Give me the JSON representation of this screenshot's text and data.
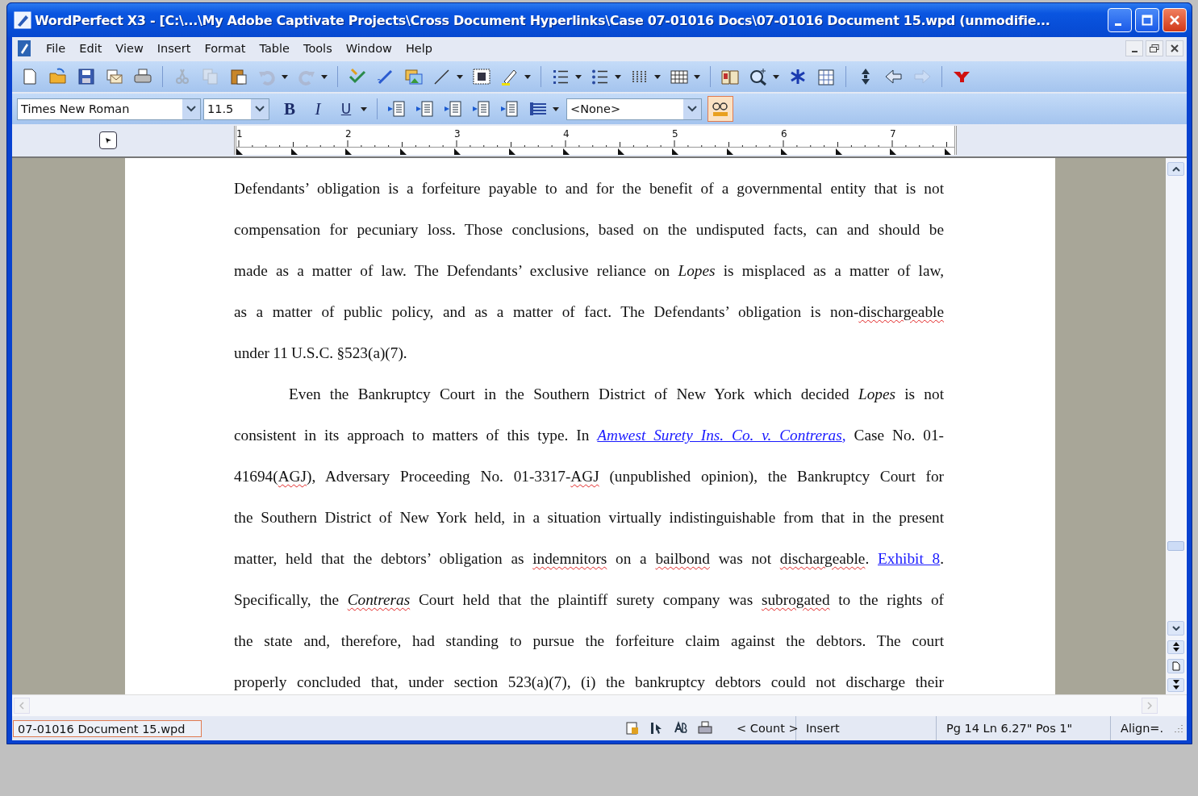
{
  "window": {
    "title": "WordPerfect X3 - [C:\\...\\My Adobe Captivate Projects\\Cross Document Hyperlinks\\Case 07-01016 Docs\\07-01016 Document 15.wpd (unmodifie..."
  },
  "menu": [
    "File",
    "Edit",
    "View",
    "Insert",
    "Format",
    "Table",
    "Tools",
    "Window",
    "Help"
  ],
  "property_bar": {
    "font": "Times New Roman",
    "size": "11.5",
    "bold": "B",
    "italic": "I",
    "underline": "U",
    "style": "<None>"
  },
  "ruler": {
    "numbers": [
      "1",
      "2",
      "3",
      "4",
      "5",
      "6",
      "7"
    ]
  },
  "document": {
    "paragraphs": [
      {
        "first_line_indent": false,
        "continues": false,
        "lines": [
          [
            {
              "kind": "text",
              "text": "Defendants’ obligation is a forfeiture payable to and for the benefit of a governmental entity that is not"
            }
          ],
          [
            {
              "kind": "text",
              "text": "compensation for pecuniary loss. Those conclusions, based on the undisputed facts, can and should be"
            }
          ],
          [
            {
              "kind": "text",
              "text": "made as a matter of law. The Defendants’ exclusive reliance on *Lopes* is misplaced as a matter of law,"
            }
          ],
          [
            {
              "kind": "text",
              "text": "as a matter of public policy, and as a matter of fact. The Defendants’ obligation is non-"
            },
            {
              "kind": "misspelled",
              "text": "dischargeable"
            }
          ],
          [
            {
              "kind": "text",
              "text": "under 11 U.S.C. §523(a)(7)."
            }
          ]
        ]
      },
      {
        "first_line_indent": true,
        "continues": true,
        "lines": [
          [
            {
              "kind": "text",
              "text": "Even the Bankruptcy Court in the Southern District of New York which decided *Lopes* is not"
            }
          ],
          [
            {
              "kind": "text",
              "text": "consistent in its approach to matters of this type. In "
            },
            {
              "kind": "link",
              "text": "*Amwest Surety Ins. Co. v. Contreras*,"
            },
            {
              "kind": "text",
              "text": " Case No. 01-"
            }
          ],
          [
            {
              "kind": "text",
              "text": "41694("
            },
            {
              "kind": "misspelled",
              "text": "AGJ"
            },
            {
              "kind": "text",
              "text": "), Adversary Proceeding No. 01-3317-"
            },
            {
              "kind": "misspelled",
              "text": "AGJ"
            },
            {
              "kind": "text",
              "text": " (unpublished opinion), the Bankruptcy Court for"
            }
          ],
          [
            {
              "kind": "text",
              "text": "the Southern District of New York held, in a situation virtually indistinguishable from that in the present"
            }
          ],
          [
            {
              "kind": "text",
              "text": "matter, held that the debtors’ obligation as "
            },
            {
              "kind": "misspelled",
              "text": "indemnitors"
            },
            {
              "kind": "text",
              "text": " on a "
            },
            {
              "kind": "misspelled",
              "text": "bailbond"
            },
            {
              "kind": "text",
              "text": " was not "
            },
            {
              "kind": "misspelled",
              "text": "dischargeable"
            },
            {
              "kind": "text",
              "text": ". "
            },
            {
              "kind": "link",
              "text": "Exhibit 8"
            },
            {
              "kind": "text",
              "text": "."
            }
          ],
          [
            {
              "kind": "text",
              "text": "Specifically, the "
            },
            {
              "kind": "misspelled",
              "text": "*Contreras*"
            },
            {
              "kind": "text",
              "text": " Court held that the plaintiff surety company was "
            },
            {
              "kind": "misspelled",
              "text": "subrogated"
            },
            {
              "kind": "text",
              "text": " to the rights of"
            }
          ],
          [
            {
              "kind": "text",
              "text": "the state and, therefore, had standing to pursue the forfeiture claim against the debtors. The court"
            }
          ],
          [
            {
              "kind": "text",
              "text": "properly concluded that, under section 523(a)(7), (i) the bankruptcy debtors could not discharge their"
            }
          ]
        ]
      }
    ]
  },
  "status_bar": {
    "file": "07-01016 Document 15.wpd",
    "count": "< Count >",
    "mode": "Insert",
    "position": "Pg 14 Ln 6.27\" Pos 1\"",
    "align": "Align=."
  }
}
